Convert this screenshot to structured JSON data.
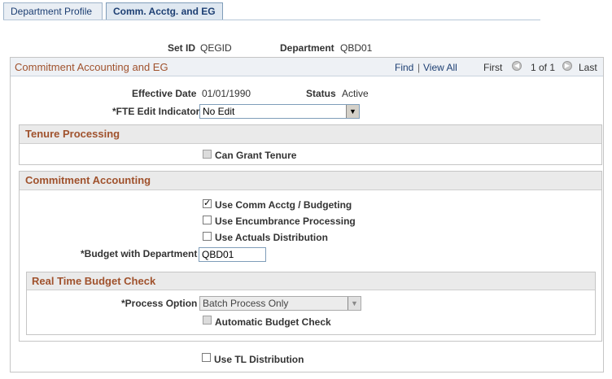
{
  "tabs": [
    {
      "label": "Department Profile",
      "active": false
    },
    {
      "label": "Comm. Acctg. and EG",
      "active": true
    }
  ],
  "header": {
    "setid_label": "Set ID",
    "setid_value": "QEGID",
    "dept_label": "Department",
    "dept_value": "QBD01"
  },
  "main_section": {
    "title": "Commitment Accounting and EG",
    "find_label": "Find",
    "separator": "|",
    "view_all_label": "View All",
    "first_label": "First",
    "page_counter": "1 of 1",
    "last_label": "Last",
    "effective_date_label": "Effective Date",
    "effective_date_value": "01/01/1990",
    "status_label": "Status",
    "status_value": "Active",
    "fte_label": "*FTE Edit Indicator",
    "fte_value": "No Edit"
  },
  "tenure": {
    "title": "Tenure Processing",
    "can_grant_tenure_label": "Can Grant Tenure",
    "can_grant_tenure_checked": false
  },
  "commitment": {
    "title": "Commitment Accounting",
    "use_comm_acctg_label": "Use Comm Acctg / Budgeting",
    "use_comm_acctg_checked": true,
    "use_encumbrance_label": "Use Encumbrance Processing",
    "use_actuals_label": "Use Actuals Distribution",
    "budget_dept_label": "*Budget with Department",
    "budget_dept_value": "QBD01"
  },
  "realtime": {
    "title": "Real Time Budget Check",
    "process_option_label": "*Process Option",
    "process_option_value": "Batch Process Only",
    "auto_budget_check_label": "Automatic Budget Check"
  },
  "footer": {
    "use_tl_label": "Use TL Distribution"
  }
}
